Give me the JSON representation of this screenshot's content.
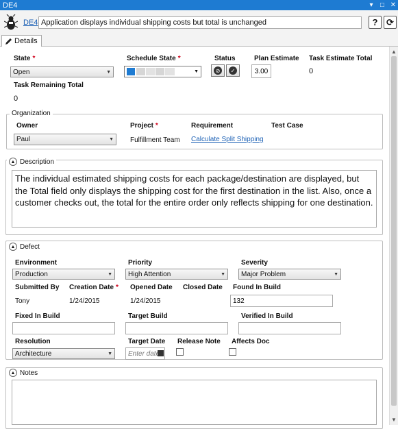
{
  "window": {
    "title": "DE4",
    "min_symbol": "▾",
    "max_symbol": "□",
    "close_symbol": "✕"
  },
  "header": {
    "id_link": "DE4",
    "title_value": "Application displays individual shipping costs but total is unchanged",
    "help_symbol": "?",
    "refresh_symbol": "⟳"
  },
  "tabs": [
    {
      "label": "Details",
      "selected": true
    }
  ],
  "details": {
    "state": {
      "label": "State",
      "value": "Open"
    },
    "schedule_state": {
      "label": "Schedule State"
    },
    "status": {
      "label": "Status"
    },
    "plan_estimate": {
      "label": "Plan Estimate",
      "value": "3.00"
    },
    "task_estimate_total": {
      "label": "Task Estimate Total",
      "value": "0"
    },
    "task_remaining_total": {
      "label": "Task Remaining Total",
      "value": "0"
    },
    "required_marker": "*"
  },
  "organization": {
    "legend": "Organization",
    "owner": {
      "label": "Owner",
      "value": "Paul"
    },
    "project": {
      "label": "Project",
      "value": "Fulfillment Team"
    },
    "requirement": {
      "label": "Requirement",
      "value": "Calculate Split Shipping"
    },
    "test_case": {
      "label": "Test Case"
    }
  },
  "description": {
    "legend": "Description",
    "text": "The individual estimated shipping costs for each package/destination are displayed, but the Total field only displays the shipping cost for the first destination in the list. Also, once a customer checks out, the total for the entire order only reflects shipping for one destination."
  },
  "defect": {
    "legend": "Defect",
    "environment": {
      "label": "Environment",
      "value": "Production"
    },
    "priority": {
      "label": "Priority",
      "value": "High Attention"
    },
    "severity": {
      "label": "Severity",
      "value": "Major Problem"
    },
    "submitted_by": {
      "label": "Submitted By",
      "value": "Tony"
    },
    "creation_date": {
      "label": "Creation Date",
      "value": "1/24/2015"
    },
    "opened_date": {
      "label": "Opened Date",
      "value": "1/24/2015"
    },
    "closed_date": {
      "label": "Closed Date"
    },
    "found_in_build": {
      "label": "Found In Build",
      "value": "132"
    },
    "fixed_in_build": {
      "label": "Fixed In Build",
      "value": ""
    },
    "target_build": {
      "label": "Target Build",
      "value": ""
    },
    "verified_in_build": {
      "label": "Verified In Build",
      "value": ""
    },
    "resolution": {
      "label": "Resolution",
      "value": "Architecture"
    },
    "target_date": {
      "label": "Target Date",
      "placeholder": "Enter date"
    },
    "release_note": {
      "label": "Release Note",
      "checked": false
    },
    "affects_doc": {
      "label": "Affects Doc",
      "checked": false
    }
  },
  "notes": {
    "legend": "Notes",
    "text": ""
  },
  "colors": {
    "titlebar": "#1e7bd2",
    "link": "#1a5fb4",
    "required": "#d0021b"
  }
}
